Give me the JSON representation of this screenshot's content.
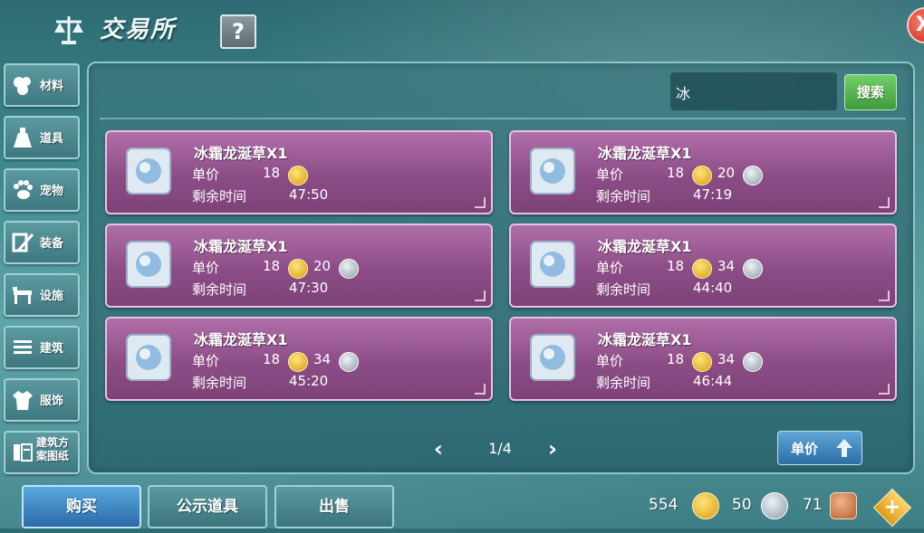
{
  "header": {
    "title": "交易所",
    "help_label": "?",
    "close_label": "X"
  },
  "sidebar": {
    "items": [
      {
        "label": "材料",
        "icon": "materials-icon"
      },
      {
        "label": "道具",
        "icon": "potion-icon"
      },
      {
        "label": "宠物",
        "icon": "paw-icon"
      },
      {
        "label": "装备",
        "icon": "equipment-icon"
      },
      {
        "label": "设施",
        "icon": "facility-icon"
      },
      {
        "label": "建筑",
        "icon": "building-icon"
      },
      {
        "label": "服饰",
        "icon": "clothing-icon"
      },
      {
        "label": "建筑方案图纸",
        "icon": "blueprint-icon"
      }
    ]
  },
  "search": {
    "value": "冰",
    "button_label": "搜索"
  },
  "listings": [
    {
      "name": "冰霜龙涎草X1",
      "price_label": "单价",
      "gold": "18",
      "silver": "",
      "time_label": "剩余时间",
      "time": "47:50"
    },
    {
      "name": "冰霜龙涎草X1",
      "price_label": "单价",
      "gold": "18",
      "silver": "20",
      "time_label": "剩余时间",
      "time": "47:19"
    },
    {
      "name": "冰霜龙涎草X1",
      "price_label": "单价",
      "gold": "18",
      "silver": "20",
      "time_label": "剩余时间",
      "time": "47:30"
    },
    {
      "name": "冰霜龙涎草X1",
      "price_label": "单价",
      "gold": "18",
      "silver": "34",
      "time_label": "剩余时间",
      "time": "44:40"
    },
    {
      "name": "冰霜龙涎草X1",
      "price_label": "单价",
      "gold": "18",
      "silver": "34",
      "time_label": "剩余时间",
      "time": "45:20"
    },
    {
      "name": "冰霜龙涎草X1",
      "price_label": "单价",
      "gold": "18",
      "silver": "34",
      "time_label": "剩余时间",
      "time": "46:44"
    }
  ],
  "pagination": {
    "current": "1/4"
  },
  "sort": {
    "label": "单价"
  },
  "tabs": {
    "buy": "购买",
    "public": "公示道具",
    "sell": "出售"
  },
  "currency": {
    "gold": "554",
    "silver": "50",
    "copper": "71"
  },
  "colors": {
    "card": "#8c4d86",
    "accent_green": "#4fae46",
    "accent_blue": "#3a7fc0"
  }
}
